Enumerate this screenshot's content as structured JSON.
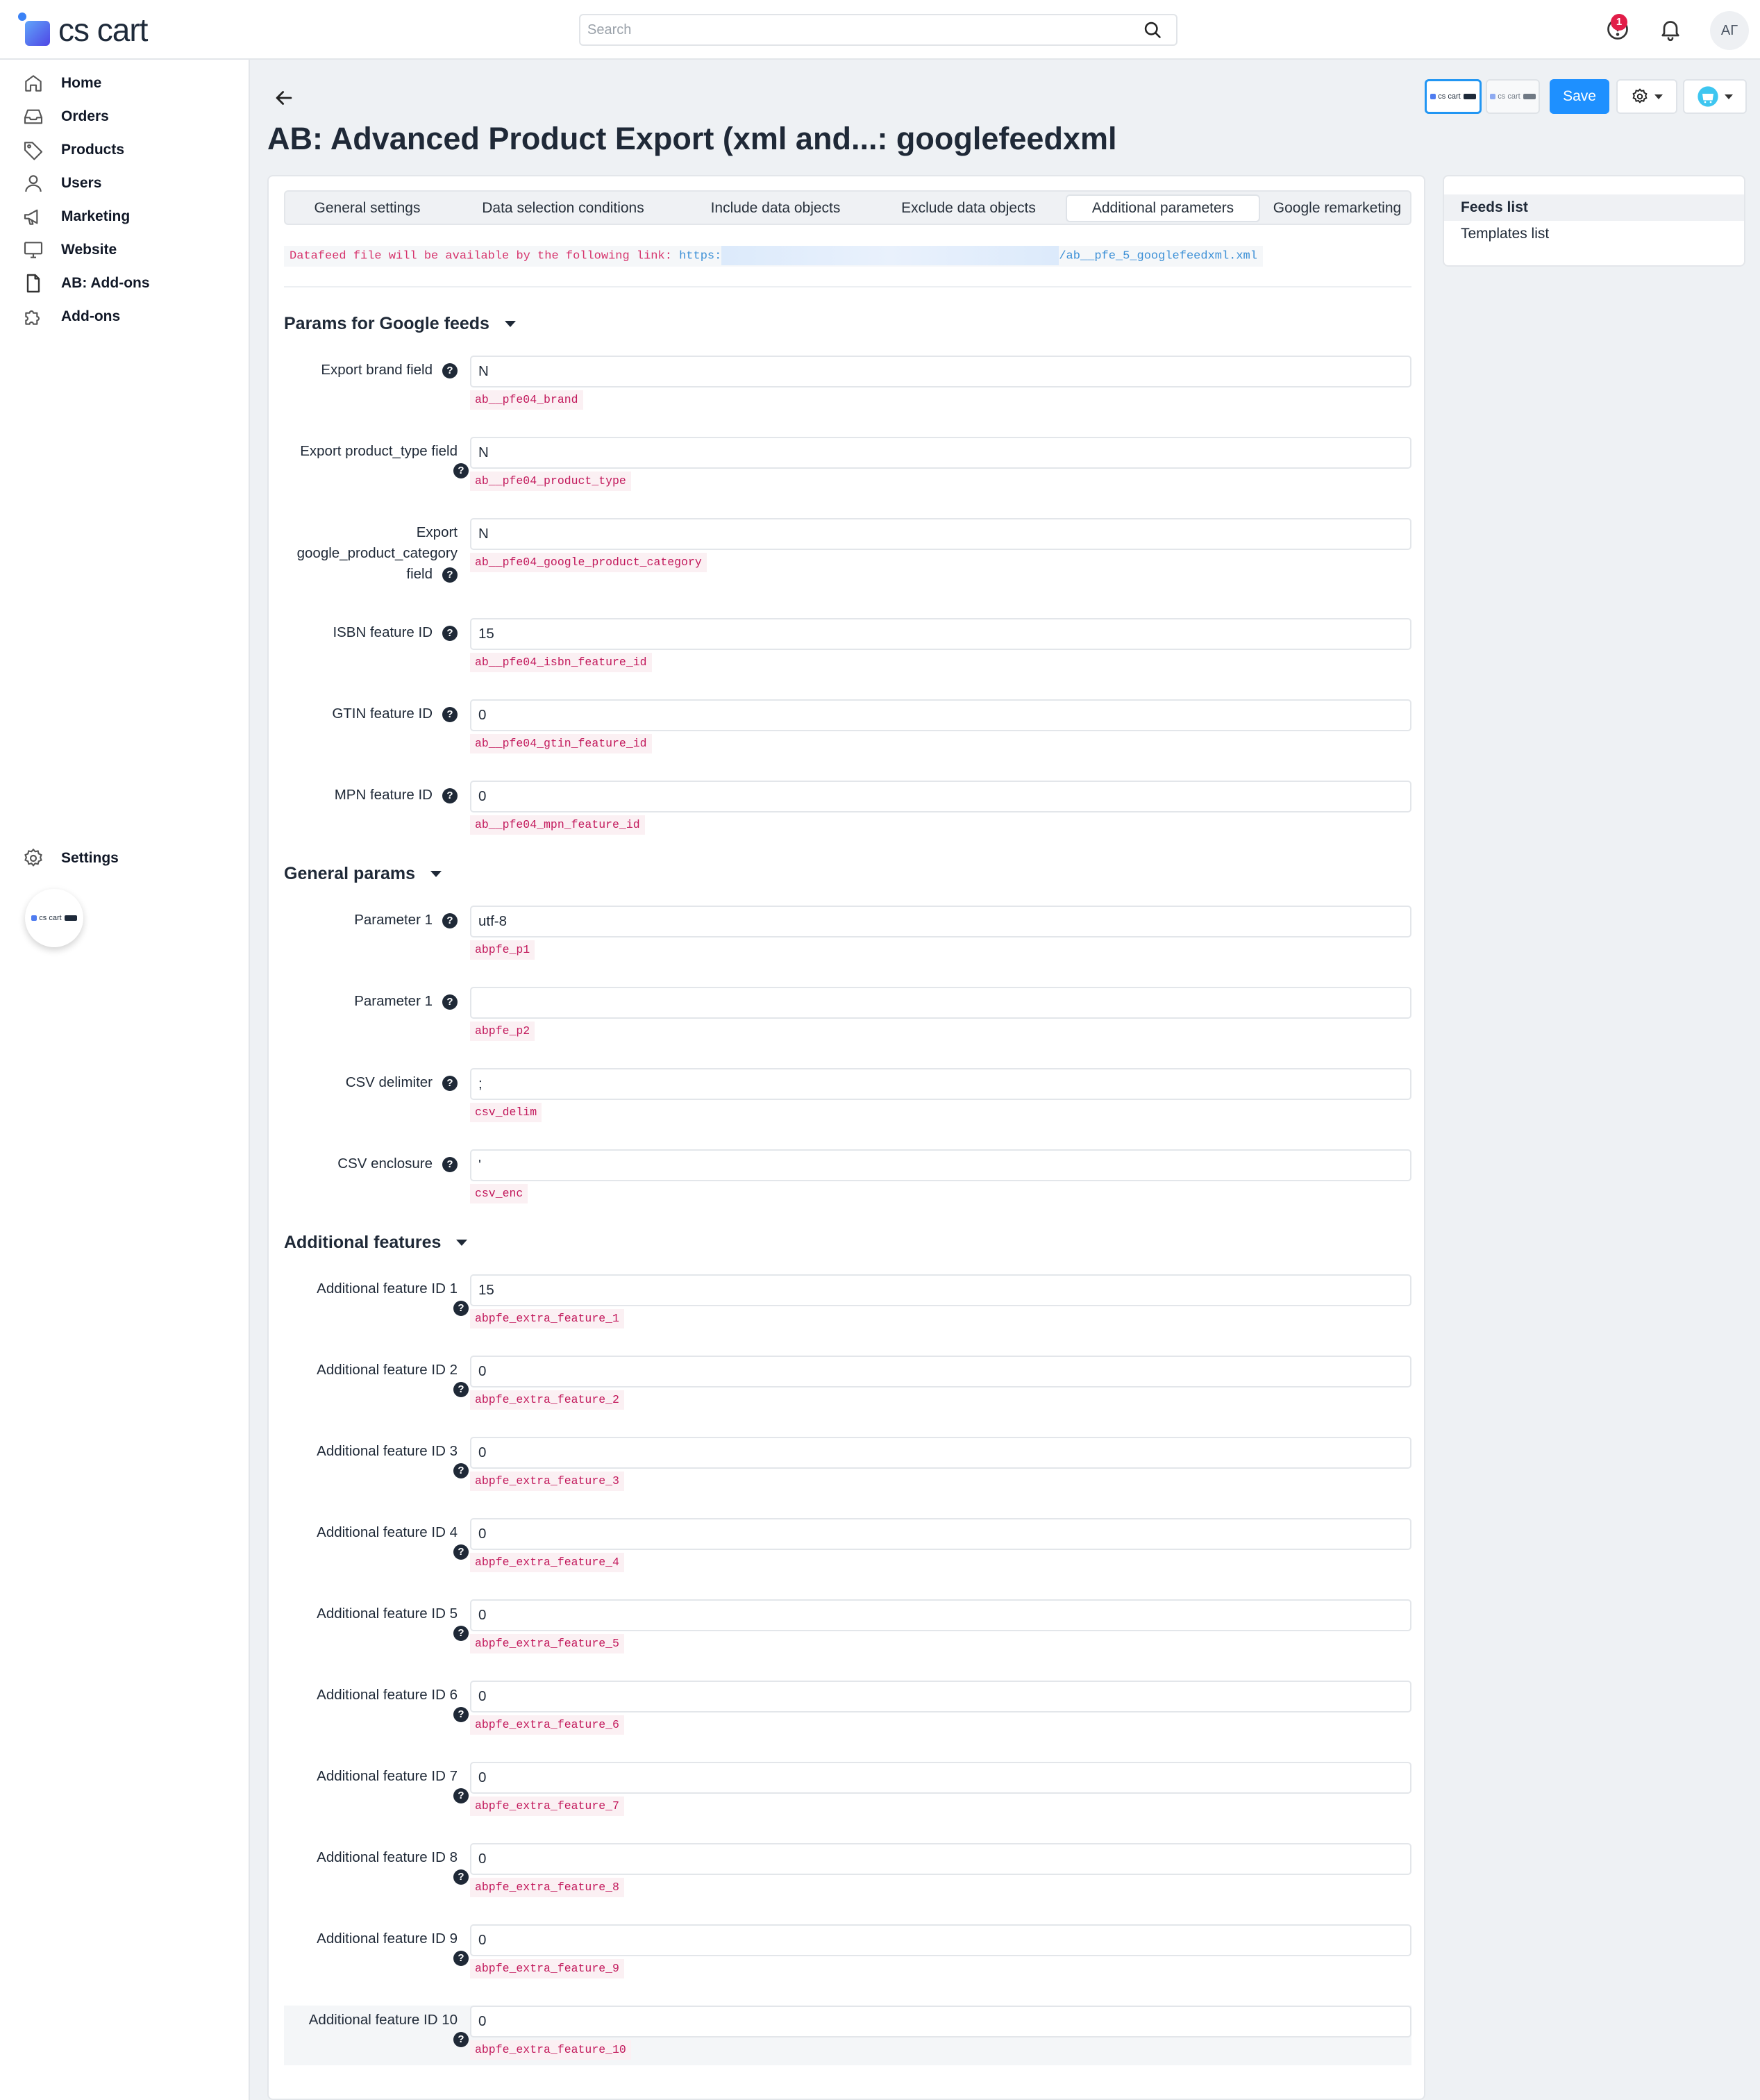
{
  "header": {
    "logo_text": "cs cart",
    "search_placeholder": "Search",
    "notification_count": "1",
    "avatar_initials": "АГ"
  },
  "sidebar": {
    "items": [
      {
        "label": "Home",
        "icon": "home-icon"
      },
      {
        "label": "Orders",
        "icon": "inbox-icon"
      },
      {
        "label": "Products",
        "icon": "tag-icon"
      },
      {
        "label": "Users",
        "icon": "user-icon"
      },
      {
        "label": "Marketing",
        "icon": "megaphone-icon"
      },
      {
        "label": "Website",
        "icon": "monitor-icon"
      },
      {
        "label": "AB: Add-ons",
        "icon": "document-icon"
      },
      {
        "label": "Add-ons",
        "icon": "puzzle-icon"
      }
    ],
    "settings_label": "Settings"
  },
  "page": {
    "title": "AB: Advanced Product Export (xml and...: googlefeedxml",
    "save_label": "Save"
  },
  "tabs": [
    {
      "label": "General settings",
      "active": false
    },
    {
      "label": "Data selection conditions",
      "active": false
    },
    {
      "label": "Include data objects",
      "active": false
    },
    {
      "label": "Exclude data objects",
      "active": false
    },
    {
      "label": "Additional parameters",
      "active": true
    },
    {
      "label": "Google remarketing",
      "active": false
    }
  ],
  "feed_link": {
    "text": "Datafeed file will be available by the following link: ",
    "url_start": "https:",
    "url_end": "/ab__pfe_5_googlefeedxml.xml"
  },
  "sections": {
    "google": "Params for Google feeds",
    "general": "General params",
    "additional": "Additional features"
  },
  "google_fields": [
    {
      "label": "Export brand field",
      "value": "N",
      "code": "ab__pfe04_brand"
    },
    {
      "label": "Export product_type field",
      "value": "N",
      "code": "ab__pfe04_product_type"
    },
    {
      "label": "Export google_product_category field",
      "value": "N",
      "code": "ab__pfe04_google_product_category"
    },
    {
      "label": "ISBN feature ID",
      "value": "15",
      "code": "ab__pfe04_isbn_feature_id"
    },
    {
      "label": "GTIN feature ID",
      "value": "0",
      "code": "ab__pfe04_gtin_feature_id"
    },
    {
      "label": "MPN feature ID",
      "value": "0",
      "code": "ab__pfe04_mpn_feature_id"
    }
  ],
  "general_fields": [
    {
      "label": "Parameter 1",
      "value": "utf-8",
      "code": "abpfe_p1"
    },
    {
      "label": "Parameter 1",
      "value": "",
      "code": "abpfe_p2"
    },
    {
      "label": "CSV delimiter",
      "value": ";",
      "code": "csv_delim"
    },
    {
      "label": "CSV enclosure",
      "value": "'",
      "code": "csv_enc"
    }
  ],
  "additional_fields": [
    {
      "label": "Additional feature ID 1",
      "value": "15",
      "code": "abpfe_extra_feature_1"
    },
    {
      "label": "Additional feature ID 2",
      "value": "0",
      "code": "abpfe_extra_feature_2"
    },
    {
      "label": "Additional feature ID 3",
      "value": "0",
      "code": "abpfe_extra_feature_3"
    },
    {
      "label": "Additional feature ID 4",
      "value": "0",
      "code": "abpfe_extra_feature_4"
    },
    {
      "label": "Additional feature ID 5",
      "value": "0",
      "code": "abpfe_extra_feature_5"
    },
    {
      "label": "Additional feature ID 6",
      "value": "0",
      "code": "abpfe_extra_feature_6"
    },
    {
      "label": "Additional feature ID 7",
      "value": "0",
      "code": "abpfe_extra_feature_7"
    },
    {
      "label": "Additional feature ID 8",
      "value": "0",
      "code": "abpfe_extra_feature_8"
    },
    {
      "label": "Additional feature ID 9",
      "value": "0",
      "code": "abpfe_extra_feature_9"
    },
    {
      "label": "Additional feature ID 10",
      "value": "0",
      "code": "abpfe_extra_feature_10"
    }
  ],
  "right_panel": {
    "items": [
      {
        "label": "Feeds list",
        "active": true
      },
      {
        "label": "Templates list",
        "active": false
      }
    ]
  },
  "colors": {
    "accent": "#1e90ff",
    "code_text": "#c2185b",
    "badge": "#e11d48"
  }
}
